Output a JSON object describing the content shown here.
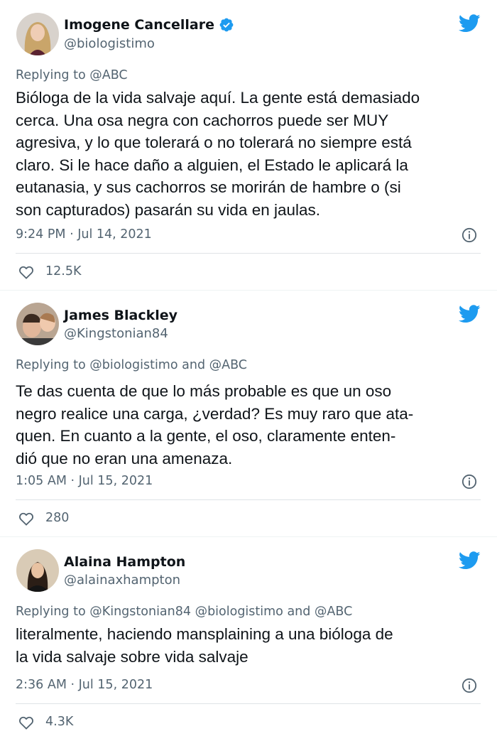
{
  "colors": {
    "brand_blue": "#1d9bf0",
    "verified_blue": "#1d9bf0",
    "text_secondary": "#536471"
  },
  "tweets": [
    {
      "name": "Imogene Cancellare",
      "verified": true,
      "handle": "@biologistimo",
      "reply_prefix": "Replying to",
      "reply_to": "@ABC",
      "text_lines": [
        "Bióloga de la vida salvaje aquí. La gente está demasiado",
        "cerca. Una osa negra con cachorros puede ser MUY",
        "agresiva, y lo que tolerará o no tolerará no siempre está",
        "claro. Si le hace daño a alguien, el Estado le aplicará la",
        "eutanasia, y sus cachorros se morirán de hambre o (si",
        "son capturados) pasarán su vida en jaulas."
      ],
      "timestamp": "9:24 PM · Jul 14, 2021",
      "likes": "12.5K"
    },
    {
      "name": "James Blackley",
      "verified": false,
      "handle": "@Kingstonian84",
      "reply_prefix": "Replying to",
      "reply_to": "@biologistimo and @ABC",
      "text_lines": [
        "Te das cuenta de que lo más probable es que un oso",
        "negro realice una carga, ¿verdad? Es muy raro que ata-",
        "quen. En cuanto a la gente, el oso, claramente enten-",
        "dió que no eran una amenaza."
      ],
      "timestamp": "1:05 AM · Jul 15, 2021",
      "likes": "280"
    },
    {
      "name": "Alaina Hampton",
      "verified": false,
      "handle": "@alainaxhampton",
      "reply_prefix": "Replying to",
      "reply_to": "@Kingstonian84 @biologistimo and @ABC",
      "text_lines": [
        "literalmente, haciendo mansplaining a una bióloga de",
        "la vida salvaje sobre vida salvaje"
      ],
      "timestamp": "2:36 AM · Jul 15, 2021",
      "likes": "4.3K"
    }
  ],
  "icons": {
    "brand": "twitter-bird-icon",
    "verified": "verified-badge-icon",
    "info": "info-icon",
    "like": "heart-icon"
  }
}
